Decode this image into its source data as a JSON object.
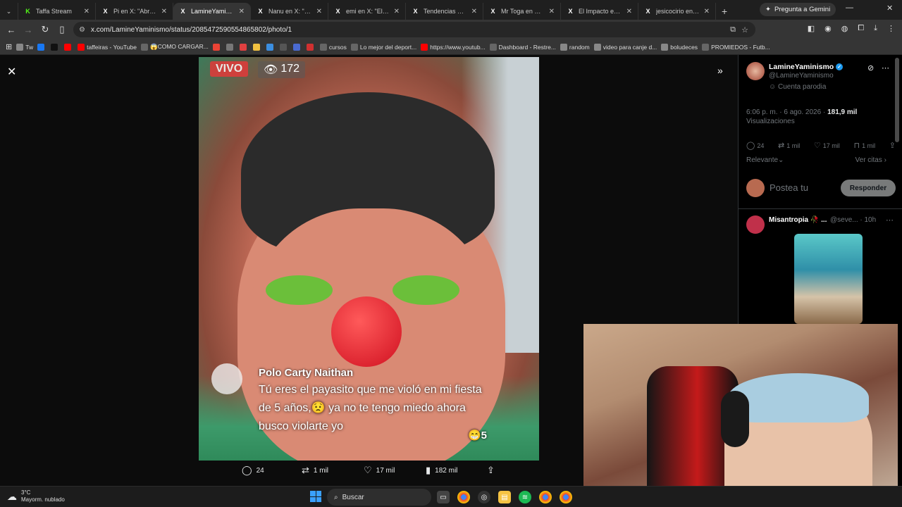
{
  "browser": {
    "tabs": [
      {
        "title": "Taffa Stream",
        "fav": "K",
        "fav_color": "#53fc18",
        "active": false
      },
      {
        "title": "Pi en X: \"Abro hi",
        "fav": "X",
        "fav_color": "#ffffff",
        "active": false
      },
      {
        "title": "LamineYaminismo",
        "fav": "X",
        "fav_color": "#ffffff",
        "active": true
      },
      {
        "title": "Nanu en X: \"PITU",
        "fav": "X",
        "fav_color": "#ffffff",
        "active": false
      },
      {
        "title": "emi en X: \"El desc",
        "fav": "X",
        "fav_color": "#ffffff",
        "active": false
      },
      {
        "title": "Tendencias en Ar",
        "fav": "X",
        "fav_color": "#ffffff",
        "active": false
      },
      {
        "title": "Mr Toga en X: \"@",
        "fav": "X",
        "fav_color": "#ffffff",
        "active": false
      },
      {
        "title": "El Impacto en X:",
        "fav": "X",
        "fav_color": "#ffffff",
        "active": false
      },
      {
        "title": "jesicocirio en X: \"",
        "fav": "X",
        "fav_color": "#ffffff",
        "active": false
      }
    ],
    "new_tab": "+",
    "gemini_label": "Pregunta a Gemini",
    "url": "x.com/LamineYaminismo/status/2085472590554865802/photo/1",
    "bookmarks": [
      {
        "label": "Tw",
        "color": "#888"
      },
      {
        "label": "",
        "color": "#1877f2"
      },
      {
        "label": "",
        "color": "#111"
      },
      {
        "label": "",
        "color": "#ff0000"
      },
      {
        "label": "taffeiras - YouTube",
        "color": "#ff0000"
      },
      {
        "label": "😱COMO CARGAR...",
        "color": "#666"
      },
      {
        "label": "",
        "color": "#ea4335"
      },
      {
        "label": "",
        "color": "#777"
      },
      {
        "label": "",
        "color": "#e04040"
      },
      {
        "label": "",
        "color": "#f0c040"
      },
      {
        "label": "",
        "color": "#3b8ee0"
      },
      {
        "label": "",
        "color": "#555"
      },
      {
        "label": "",
        "color": "#4a6ad0"
      },
      {
        "label": "",
        "color": "#d03030"
      },
      {
        "label": "cursos",
        "color": "#666"
      },
      {
        "label": "Lo mejor del deport...",
        "color": "#666"
      },
      {
        "label": "https://www.youtub...",
        "color": "#ff0000"
      },
      {
        "label": "Dashboard - Restre...",
        "color": "#666"
      },
      {
        "label": "random",
        "color": "#888"
      },
      {
        "label": "video para canje d...",
        "color": "#888"
      },
      {
        "label": "boludeces",
        "color": "#888"
      },
      {
        "label": "PROMIEDOS - Futb...",
        "color": "#666"
      }
    ]
  },
  "photo": {
    "live_badge": "VIVO",
    "viewer_count": "172",
    "comment_user": "Polo Carty Naithan",
    "comment_text": "Tú eres el payasito que me violó en mi fiesta de 5 años,😟 ya no te tengo miedo ahora busco violarte yo",
    "reaction_count": "😁5"
  },
  "viewer_actions": {
    "replies": "24",
    "reposts": "1 mil",
    "likes": "17 mil",
    "views": "182 mil"
  },
  "post": {
    "display_name": "LamineYaminismo",
    "handle": "@LamineYaminismo",
    "label": "Cuenta parodia",
    "time": "6:06 p. m. · 6 ago. 2026 ·",
    "views_value": "181,9 mil",
    "views_label": "Visualizaciones",
    "stats": {
      "replies": "24",
      "reposts": "1 mil",
      "likes": "17 mil",
      "bookmarks": "1 mil"
    },
    "sort_label": "Relevante",
    "quotes_label": "Ver citas",
    "reply_placeholder": "Postea tu",
    "reply_button": "Responder"
  },
  "reply": {
    "name": "Misantropia 🥀 ...",
    "handle_time": "@seve... · 10h"
  },
  "taskbar": {
    "temp": "3°C",
    "weather": "Mayorm. nublado",
    "search_placeholder": "Buscar"
  }
}
